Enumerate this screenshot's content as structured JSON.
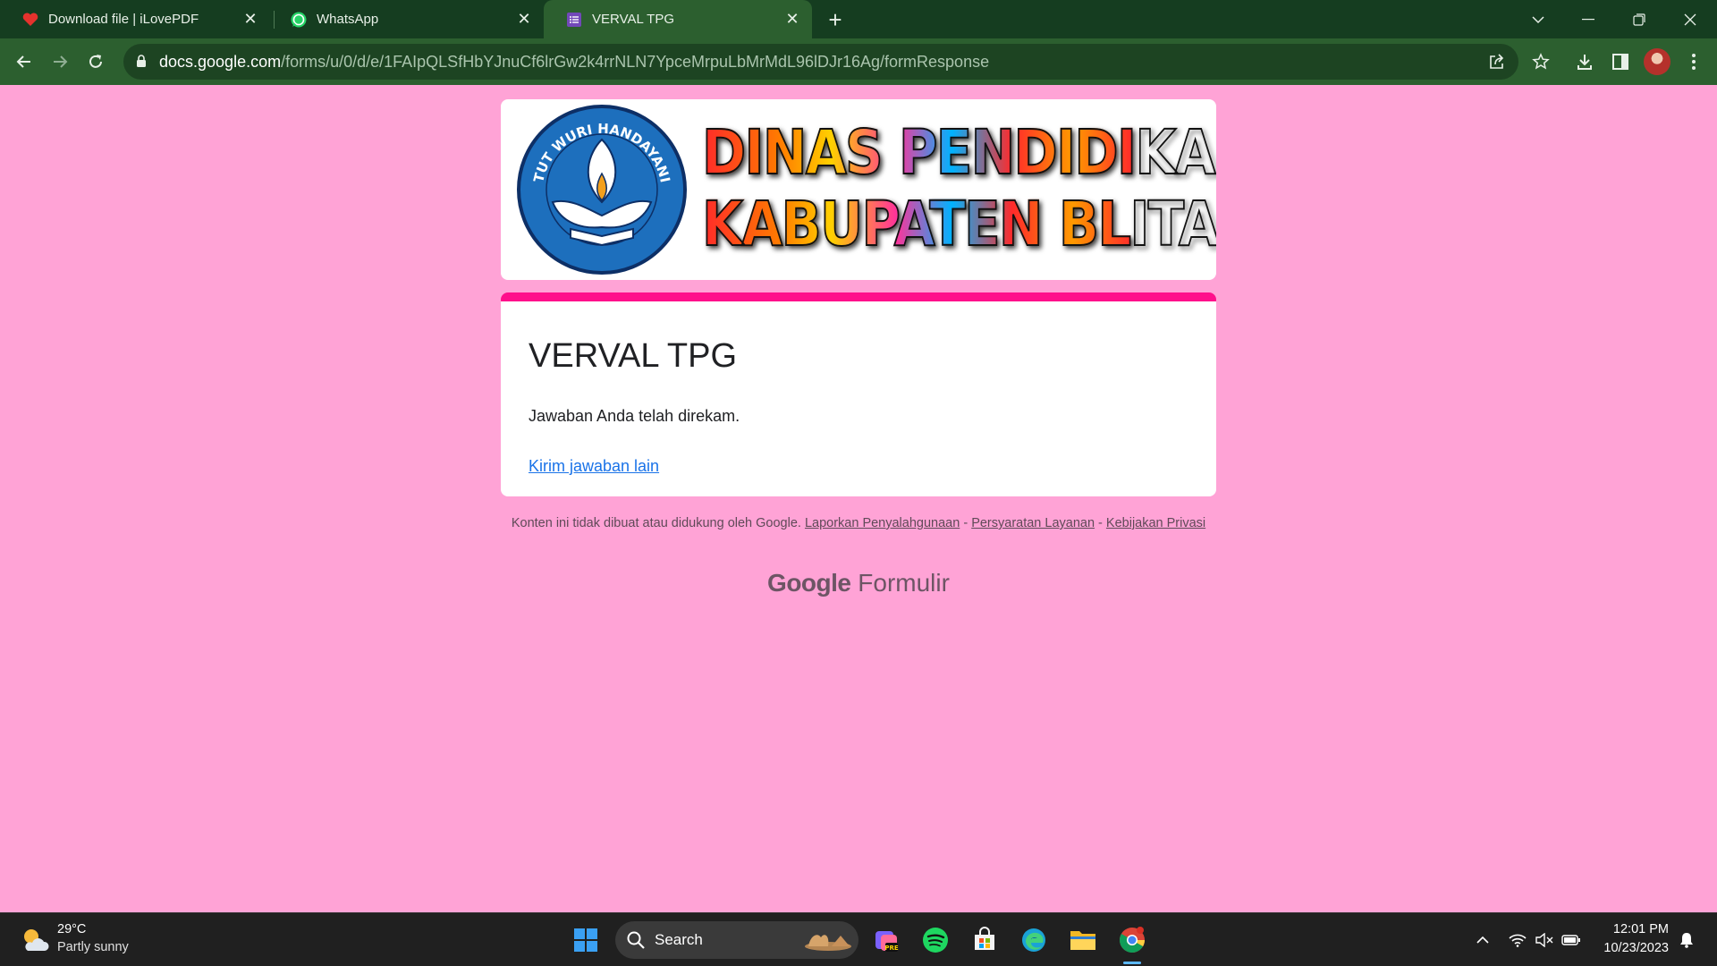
{
  "tabs": [
    {
      "title": "Download file | iLovePDF",
      "icon": "heart-icon",
      "active": false
    },
    {
      "title": "WhatsApp",
      "icon": "whatsapp-icon",
      "active": false
    },
    {
      "title": "VERVAL TPG",
      "icon": "google-forms-icon",
      "active": true
    }
  ],
  "toolbar": {
    "url_host": "docs.google.com",
    "url_path": "/forms/u/0/d/e/1FAIpQLSfHbYJnuCf6lrGw2k4rrNLN7YpceMrpuLbMrMdL96lDJr16Ag/formResponse"
  },
  "banner": {
    "logo_motto": "TUT WURI HANDAYANI",
    "line1": "DINAS PENDIDIKAN",
    "line2": "KABUPATEN BLITAR"
  },
  "form": {
    "title": "VERVAL TPG",
    "confirmation": "Jawaban Anda telah direkam.",
    "another_response_link": "Kirim jawaban lain",
    "accent_color": "#ff0f8b",
    "background_color": "#ffa3d6"
  },
  "footer": {
    "disclaimer": "Konten ini tidak dibuat atau didukung oleh Google.",
    "report_abuse": "Laporkan Penyalahgunaan",
    "terms": "Persyaratan Layanan",
    "privacy": "Kebijakan Privasi",
    "sep": " - ",
    "brand_google": "Google",
    "brand_forms": "Formulir"
  },
  "taskbar": {
    "weather_temp": "29°C",
    "weather_desc": "Partly sunny",
    "search_label": "Search",
    "time": "12:01 PM",
    "date": "10/23/2023"
  }
}
